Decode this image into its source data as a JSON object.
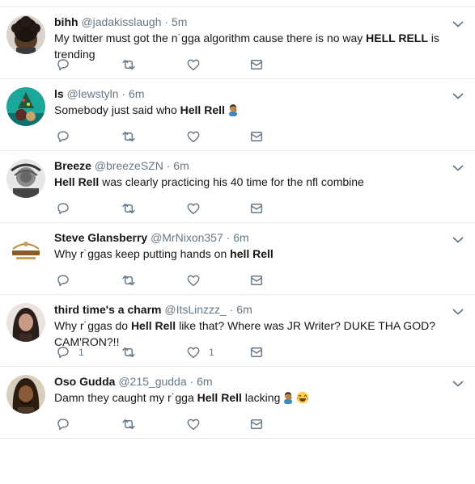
{
  "tweets": [
    {
      "name": "bihh",
      "handle": "@jadakisslaugh",
      "time": "5m",
      "text": [
        {
          "t": "My twitter must got the n˙ɡga algorithm cause there is no way ",
          "b": false
        },
        {
          "t": "HELL RELL",
          "b": true
        },
        {
          "t": " is trending",
          "b": false
        }
      ],
      "reply_count": "",
      "like_count": ""
    },
    {
      "name": "ls",
      "handle": "@lewstyln",
      "time": "6m",
      "text": [
        {
          "t": "Somebody just said who ",
          "b": false
        },
        {
          "t": "Hell Rell",
          "b": true
        }
      ],
      "emoji": [
        "facepalm"
      ],
      "reply_count": "",
      "like_count": ""
    },
    {
      "name": "Breeze",
      "handle": "@breezeSZN",
      "time": "6m",
      "text": [
        {
          "t": "Hell Rell",
          "b": true
        },
        {
          "t": " was clearly practicing his 40 time for the nfl combine",
          "b": false
        }
      ],
      "reply_count": "",
      "like_count": ""
    },
    {
      "name": "Steve Glansberry",
      "handle": "@MrNixon357",
      "time": "6m",
      "text": [
        {
          "t": "Why r˙ggas keep putting hands on ",
          "b": false
        },
        {
          "t": "hell Rell",
          "b": true
        }
      ],
      "reply_count": "",
      "like_count": ""
    },
    {
      "name": "third time's a charm",
      "handle": "@ItsLinzzz_",
      "time": "6m",
      "text": [
        {
          "t": "Why r˙ggas do ",
          "b": false
        },
        {
          "t": "Hell Rell",
          "b": true
        },
        {
          "t": " like that? Where was JR Writer? DUKE THA GOD? CAM'RON?!!",
          "b": false
        }
      ],
      "reply_count": "1",
      "like_count": "1"
    },
    {
      "name": "Oso Gudda",
      "handle": "@215_gudda",
      "time": "6m",
      "text": [
        {
          "t": "Damn they caught my r˙ɡga ",
          "b": false
        },
        {
          "t": "Hell Rell",
          "b": true
        },
        {
          "t": " lacking",
          "b": false
        }
      ],
      "emoji": [
        "facepalm",
        "joy"
      ],
      "reply_count": "",
      "like_count": ""
    }
  ],
  "separator": " · ",
  "icons": {
    "reply": "reply-icon",
    "retweet": "retweet-icon",
    "like": "heart-icon",
    "dm": "envelope-icon",
    "caret": "chevron-down-icon"
  },
  "colors": {
    "icon": "#657786",
    "border": "#e6ecf0",
    "name": "#14171a",
    "meta": "#657786"
  },
  "avatars": [
    "avatar-1",
    "avatar-2",
    "avatar-3",
    "avatar-4",
    "avatar-5",
    "avatar-6"
  ]
}
